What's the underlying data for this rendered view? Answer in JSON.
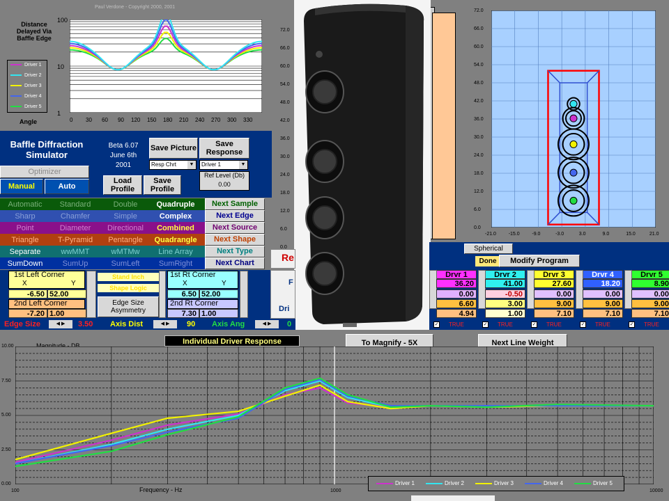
{
  "copyright": "Paul Verdone - Copyright 2000, 2001",
  "top_chart": {
    "title": "Distance Delayed Via Baffle Edge",
    "xlabel": "Angle",
    "y_ticks": [
      "100",
      "10",
      "1"
    ],
    "x_ticks": [
      "0",
      "30",
      "60",
      "90",
      "120",
      "150",
      "180",
      "210",
      "240",
      "270",
      "300",
      "330"
    ],
    "legend": [
      "Driver 1",
      "Driver 2",
      "Driver 3",
      "Driver 4",
      "Driver 5"
    ]
  },
  "app": {
    "title": "Baffle Diffraction Simulator",
    "version": "Beta 6.07",
    "date_line1": "June 6th",
    "date_line2": "2001"
  },
  "buttons": {
    "save_picture": "Save Picture",
    "save_response": "Save Response",
    "resp_chrt": "Resp Chrt",
    "driver_select": "Driver 1",
    "ref_level": "Ref Level (Db)",
    "ref_value": "0.00",
    "optimizer": "Optimizer",
    "manual": "Manual",
    "auto": "Auto",
    "load_profile": "Load Profile",
    "save_profile": "Save Profile",
    "next_sample": "Next Sample",
    "next_edge": "Next Edge",
    "next_source": "Next Source",
    "next_shape": "Next Shape",
    "next_type": "Next Type",
    "next_chart": "Next Chart",
    "spherical": "Spherical",
    "done": "Done",
    "modify_program": "Modify Program",
    "to_magnify": "To Magnify - 5X",
    "next_line_weight": "Next Line Weight",
    "stand_inch": "Stand Inch",
    "shape_logic": "Shape Logic",
    "edge_size_asym": "Edge Size Asymmetry"
  },
  "options": [
    [
      "Automatic",
      "Standard",
      "Double",
      "Quadruple"
    ],
    [
      "Sharp",
      "Chamfer",
      "Simple",
      "Complex"
    ],
    [
      "Point",
      "Diameter",
      "Directional",
      "Combined"
    ],
    [
      "Triangle",
      "T-Pyramid",
      "Pentangle",
      "Quadrangle"
    ],
    [
      "Separate",
      "wwMMT",
      "wMTMw",
      "Line Array"
    ],
    [
      "SumDown",
      "SumUp",
      "SumLeft",
      "SumRight"
    ]
  ],
  "corners": {
    "left1": "1st Left Corner",
    "left2": "2nd Left Corner",
    "right1": "1st Rt Corner",
    "right2": "2nd Rt Corner",
    "x": "X",
    "y": "Y",
    "l1x": "-6.50",
    "l1y": "52.00",
    "l2x": "-7.20",
    "l2y": "1.00",
    "r1x": "6.50",
    "r1y": "52.00",
    "r2x": "7.30",
    "r2y": "1.00"
  },
  "bottom_controls": {
    "edge_size": "Edge Size",
    "edge_size_val": "3.50",
    "axis_dist": "Axis Dist",
    "axis_dist_val": "90",
    "axis_ang": "Axis Ang",
    "axis_ang_val": "0",
    "red_fragment": "Re",
    "f_fragment": "F",
    "dri_fragment": "Dri"
  },
  "drivers": {
    "headers": [
      "Drvr 1",
      "Drvr 2",
      "Drvr 3",
      "Drvr 4",
      "Drvr 5"
    ],
    "row1": [
      "36.20",
      "41.00",
      "27.60",
      "18.20",
      "8.90"
    ],
    "row2": [
      "0.00",
      "-0.50",
      "0.00",
      "0.00",
      "0.00"
    ],
    "row3": [
      "6.60",
      "3.00",
      "9.00",
      "9.00",
      "9.00"
    ],
    "row4": [
      "4.94",
      "1.00",
      "7.10",
      "7.10",
      "7.10"
    ],
    "true_label": "TRUE",
    "check": "✓"
  },
  "layout_chart": {
    "y_ticks": [
      "72.0",
      "66.0",
      "60.0",
      "54.0",
      "48.0",
      "42.0",
      "36.0",
      "30.0",
      "24.0",
      "18.0",
      "12.0",
      "6.0",
      "0.0"
    ],
    "x_ticks": [
      "-21.0",
      "-15.0",
      "-9.0",
      "-3.0",
      "3.0",
      "9.0",
      "15.0",
      "21.0"
    ]
  },
  "mid_chart": {
    "y_ticks": [
      "72.0",
      "66.0",
      "60.0",
      "54.0",
      "48.0",
      "42.0",
      "36.0",
      "30.0",
      "24.0",
      "18.0",
      "12.0",
      "6.0",
      "0.0"
    ]
  },
  "response_chart": {
    "title": "Individual Driver Response",
    "ylabel": "Magnitude - DB",
    "xlabel": "Frequency - Hz",
    "y_ticks": [
      "10.00",
      "7.50",
      "5.00",
      "2.50",
      "0.00"
    ],
    "x_ticks": [
      "100",
      "1000",
      "10000"
    ],
    "legend": [
      "Driver 1",
      "Driver 2",
      "Driver 3",
      "Driver 4",
      "Driver 5"
    ]
  },
  "colors": {
    "d1": "#cc33cc",
    "d2": "#33e5f0",
    "d3": "#f2f200",
    "d4": "#4466ee",
    "d5": "#22dd44",
    "navy": "#003080",
    "teal": "#007070"
  },
  "chart_data": {
    "type": "line",
    "title": "Individual Driver Response",
    "xlabel": "Frequency - Hz",
    "ylabel": "Magnitude - DB",
    "x": [
      100,
      200,
      300,
      500,
      700,
      900,
      1100,
      1500,
      2000,
      3000,
      5000,
      10000
    ],
    "series": [
      {
        "name": "Driver 1",
        "values": [
          1.6,
          3.2,
          4.3,
          5.1,
          6.5,
          7.0,
          5.9,
          5.6,
          5.7,
          5.6,
          5.7,
          5.7
        ]
      },
      {
        "name": "Driver 2",
        "values": [
          1.5,
          2.9,
          4.0,
          5.0,
          6.8,
          7.5,
          6.3,
          5.6,
          5.7,
          5.6,
          5.7,
          5.7
        ]
      },
      {
        "name": "Driver 3",
        "values": [
          1.8,
          3.7,
          4.8,
          5.3,
          6.4,
          7.2,
          6.0,
          5.5,
          5.7,
          5.6,
          5.7,
          5.7
        ]
      },
      {
        "name": "Driver 4",
        "values": [
          1.5,
          2.8,
          3.8,
          4.8,
          6.9,
          7.6,
          6.4,
          5.7,
          5.7,
          5.7,
          5.7,
          5.7
        ]
      },
      {
        "name": "Driver 5",
        "values": [
          1.3,
          2.4,
          3.6,
          4.9,
          7.0,
          7.7,
          6.5,
          5.6,
          5.7,
          5.6,
          5.8,
          5.7
        ]
      }
    ],
    "ylim": [
      0,
      10
    ]
  }
}
